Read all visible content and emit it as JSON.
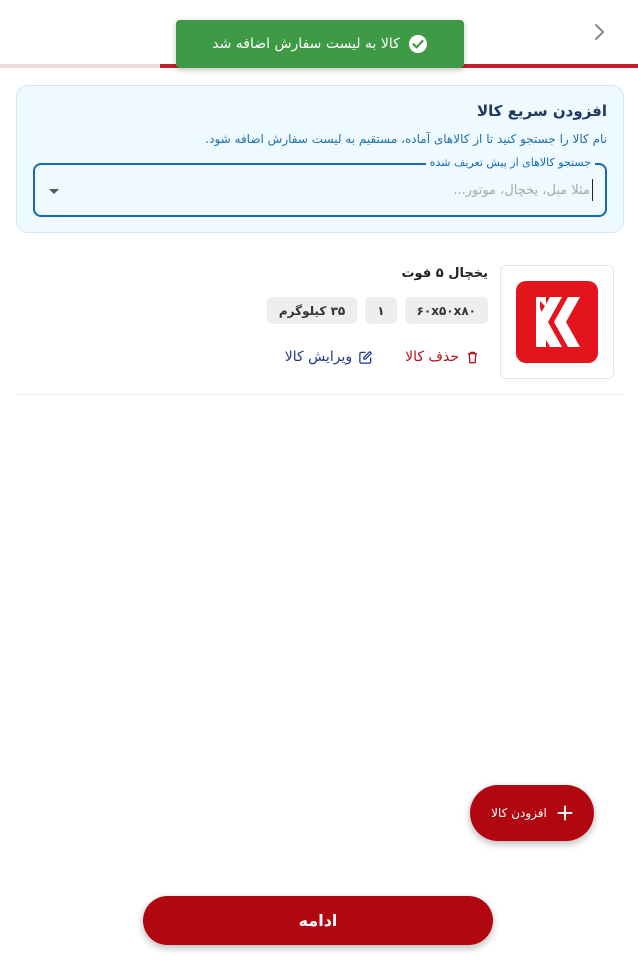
{
  "header": {
    "back_icon": "chevron-right-icon",
    "progress_fraction": 0.75,
    "progress_color": "#c41f2a"
  },
  "toast": {
    "message": "کالا به لیست سفارش اضافه شد",
    "icon": "check-circle-icon",
    "color": "#3e9a44"
  },
  "quick_add": {
    "title": "افزودن سریع کالا",
    "description": "نام کالا را جستجو کنید تا از کالاهای آماده، مستقیم به لیست سفارش اضافه شود.",
    "search_label": "جستجو کالاهای از پیش تعریف شده",
    "search_placeholder": "مثلا مبل، یخچال، موتور..."
  },
  "product": {
    "name": "یخچال ۵ فوت",
    "dimensions": "۶۰x۵۰x۸۰",
    "quantity": "۱",
    "weight": "۳۵ کیلوگرم",
    "delete_label": "حذف کالا",
    "edit_label": "ویرایش کالا"
  },
  "fab": {
    "label": "افزودن کالا"
  },
  "footer": {
    "continue_label": "ادامه"
  },
  "colors": {
    "accent": "#b00710",
    "info_bg": "#eefaff",
    "link": "#1f3a8a"
  }
}
